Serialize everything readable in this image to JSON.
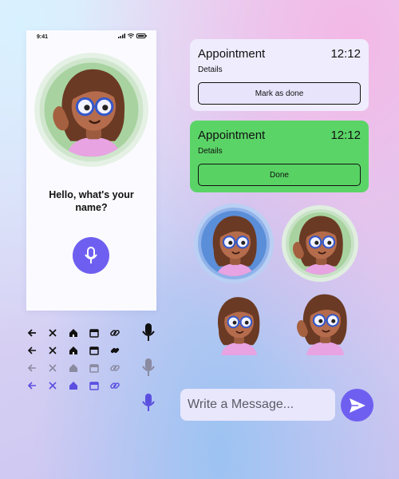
{
  "phone": {
    "status_time": "9:41",
    "greeting_line1": "Hello, what's your",
    "greeting_line2": "name?"
  },
  "cards": [
    {
      "title": "Appointment",
      "time": "12:12",
      "details": "Details",
      "button_label": "Mark as done"
    },
    {
      "title": "Appointment",
      "time": "12:12",
      "details": "Details",
      "button_label": "Done"
    }
  ],
  "message": {
    "placeholder": "Write a Message..."
  },
  "icons": {
    "row_names": [
      "arrow-left-icon",
      "close-icon",
      "home-icon",
      "calendar-icon",
      "link-icon"
    ],
    "mic": "microphone-icon",
    "send": "send-icon"
  },
  "colors": {
    "accent": "#6f5ff0",
    "done_green": "#5bd467",
    "card_lavender": "#efecfd",
    "avatar_green": "#a8d3a0",
    "avatar_blue": "#5b8ed8"
  }
}
